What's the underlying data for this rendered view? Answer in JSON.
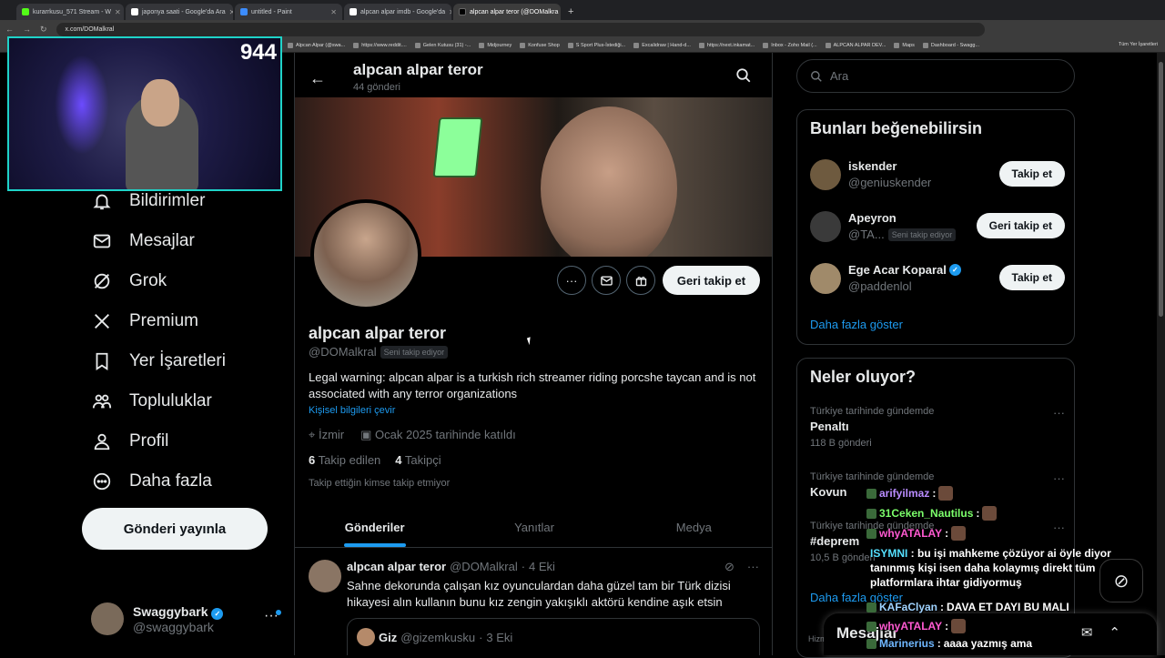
{
  "browser": {
    "tabs": [
      {
        "title": "kurarrkusu_571 Stream - W",
        "color": "#53fc18",
        "active": false
      },
      {
        "title": "japonya saati - Google'da Ara",
        "color": "#ffffff",
        "active": false
      },
      {
        "title": "untitled - Paint",
        "color": "#3c8cff",
        "active": false
      },
      {
        "title": "alpcan alpar imdb - Google'da",
        "color": "#ffffff",
        "active": false
      },
      {
        "title": "alpcan alpar teror (@DOMalkra",
        "color": "#000000",
        "active": true
      }
    ],
    "url": "x.com/DOMalkral",
    "bookmarks": [
      "Alpcan Alpar (@swa...",
      "https://www.reddit....",
      "Gelen Kutusu (31) -...",
      "Midjourney",
      "Konfuse Shop",
      "S Sport Plus-İstediği...",
      "Excalidraw | Hand-d...",
      "https://next.inkamat...",
      "Inbox - Zoho Mail (...",
      "ALPCAN ALPAR DEV...",
      "Maps",
      "Dashboard - Swagg..."
    ],
    "bookmarks_all": "Tüm Yer İşaretleri"
  },
  "webcam": {
    "viewer_count": "944"
  },
  "nav": {
    "items": [
      {
        "label": "Bildirimler",
        "icon": "bell-icon"
      },
      {
        "label": "Mesajlar",
        "icon": "mail-icon"
      },
      {
        "label": "Grok",
        "icon": "grok-icon"
      },
      {
        "label": "Premium",
        "icon": "x-logo-icon"
      },
      {
        "label": "Yer İşaretleri",
        "icon": "bookmark-icon"
      },
      {
        "label": "Topluluklar",
        "icon": "communities-icon"
      },
      {
        "label": "Profil",
        "icon": "user-icon"
      },
      {
        "label": "Daha fazla",
        "icon": "more-circle-icon"
      }
    ],
    "post_button": "Gönderi yayınla",
    "account": {
      "name": "Swaggybark",
      "handle": "@swaggybark"
    }
  },
  "profile": {
    "header_title": "alpcan alpar teror",
    "header_count": "44 gönderi",
    "name": "alpcan alpar teror",
    "handle": "@DOMalkral",
    "follows_you": "Seni takip ediyor",
    "bio": "Legal warning: alpcan alpar is a turkish rich streamer riding porcshe taycan and is not associated with any terror organizations",
    "translate": "Kişisel bilgileri çevir",
    "location": "İzmir",
    "joined": "Ocak 2025 tarihinde katıldı",
    "following_count": "6",
    "following_label": "Takip edilen",
    "followers_count": "4",
    "followers_label": "Takipçi",
    "no_mutual": "Takip ettiğin kimse takip etmiyor",
    "follow_back": "Geri takip et",
    "tabs": [
      "Gönderiler",
      "Yanıtlar",
      "Medya"
    ]
  },
  "tweet": {
    "name": "alpcan alpar teror",
    "handle": "@DOMalkral",
    "dot": "·",
    "date": "4 Eki",
    "text": "Sahne dekorunda çalışan kız oyunculardan daha güzel tam bir Türk dizisi hikayesi alın kullanın bunu kız zengin yakışıklı aktörü kendine aşık etsin",
    "quote": {
      "name": "Giz",
      "handle": "@gizemkusku",
      "date": "3 Eki"
    }
  },
  "sidebar": {
    "search_placeholder": "Ara",
    "who_title": "Bunları beğenebilirsin",
    "who": [
      {
        "name": "iskender",
        "handle": "@geniuskender",
        "button": "Takip et",
        "verified": false,
        "badge": ""
      },
      {
        "name": "Apeyron",
        "handle": "@TA...",
        "button": "Geri takip et",
        "verified": false,
        "badge": "Seni takip ediyor"
      },
      {
        "name": "Ege Acar Koparal",
        "handle": "@paddenlol",
        "button": "Takip et",
        "verified": true,
        "badge": ""
      }
    ],
    "who_more": "Daha fazla göster",
    "trends_title": "Neler oluyor?",
    "trends": [
      {
        "context": "Türkiye tarihinde gündemde",
        "topic": "Penaltı",
        "posts": "118 B gönderi"
      },
      {
        "context": "Türkiye tarihinde gündemde",
        "topic": "Kovun",
        "posts": ""
      },
      {
        "context": "Türkiye tarihinde gündemde",
        "topic": "#deprem",
        "posts": "10,5 B gönderi"
      }
    ],
    "trends_more": "Daha fazla göster",
    "footer": "Hizm"
  },
  "messages_drawer": {
    "title": "Mesajlar"
  },
  "stream_chat": [
    {
      "user": "arifyilmaz",
      "color": "#b98cff",
      "text": ""
    },
    {
      "user": "31Ceken_Nautilus",
      "color": "#7cff6b",
      "text": ""
    },
    {
      "user": "whyATALAY",
      "color": "#ff5ad1",
      "text": ""
    },
    {
      "user": "ISYMNI",
      "color": "#55e0ff",
      "text": "bu işi mahkeme çözüyor ai öyle diyor tanınmış kişi isen daha kolaymış direkt tüm platformlara ihtar gidiyormuş"
    },
    {
      "user": "KAFaClyan",
      "color": "#9fd3ff",
      "text": "DAVA ET DAYI BU MALI"
    },
    {
      "user": "whyATALAY",
      "color": "#ff5ad1",
      "text": ""
    },
    {
      "user": "Marinerius",
      "color": "#6fb7ff",
      "text": "aaaa yazmış ama"
    }
  ]
}
